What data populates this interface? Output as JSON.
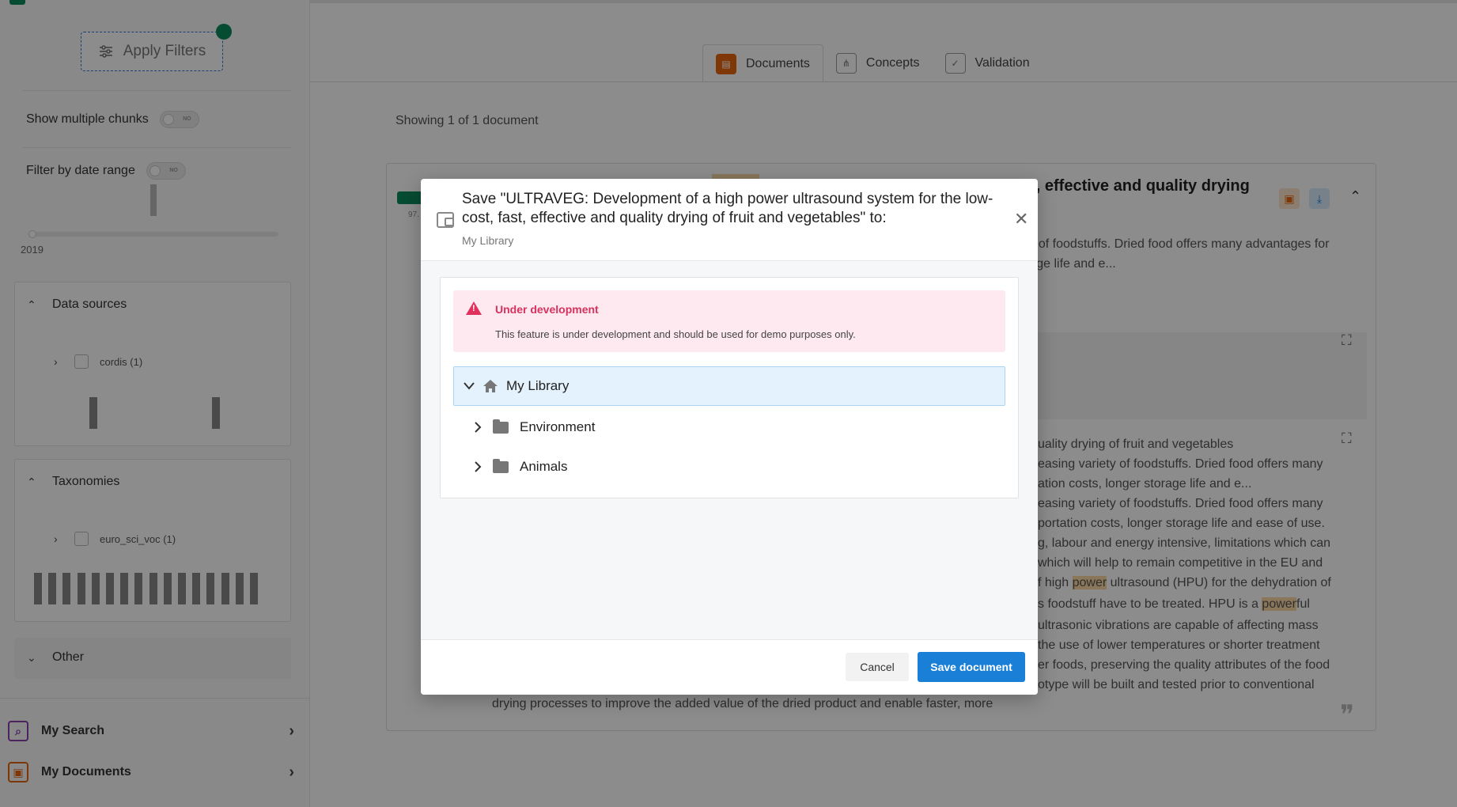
{
  "sidebar": {
    "apply_filters_label": "Apply Filters",
    "show_multiple_chunks_label": "Show multiple chunks",
    "filter_by_date_label": "Filter by date range",
    "toggle_off_text": "NO",
    "date_start_label": "2019",
    "data_sources": {
      "title": "Data sources",
      "items": [
        {
          "label": "cordis (1)"
        }
      ]
    },
    "taxonomies": {
      "title": "Taxonomies",
      "items": [
        {
          "label": "euro_sci_voc (1)"
        }
      ]
    },
    "other": {
      "title": "Other"
    },
    "nav": [
      {
        "label": "My Search",
        "icon": "search-icon",
        "color": "#8b3fb0"
      },
      {
        "label": "My Documents",
        "icon": "document-icon",
        "color": "#e8650d"
      }
    ]
  },
  "main": {
    "tabs": [
      {
        "label": "Documents",
        "active": true
      },
      {
        "label": "Concepts",
        "active": false
      },
      {
        "label": "Validation",
        "active": false
      }
    ],
    "showing_text": "Showing 1 of 1 document",
    "card": {
      "title_visible": "st, effective and quality drying",
      "snippet_lines": [
        "ty of foodstuffs. Dried food offers many advantages for",
        "rage life and e..."
      ],
      "chunk_title": "uality drying of fruit and vegetables",
      "chunk_summary_lines": [
        "easing variety of foodstuffs. Dried food offers many",
        "ation costs, longer storage life and e..."
      ],
      "body_lines": [
        "easing variety of foodstuffs. Dried food offers many",
        "portation costs, longer storage life and ease of use.",
        "g, labour and energy intensive, limitations which can",
        " which will help to remain competitive in the EU and",
        "f high ",
        "s foodstuff have to be treated. HPU is a ",
        "ultrasonic vibrations are capable of affecting mass",
        "the use of lower temperatures or shorter treatment",
        "er foods, preserving the quality attributes of the food",
        "otype will be built and tested prior to conventional",
        "drying processes to improve the added value of the dried product and enable faster, more"
      ],
      "highlight_word": "power",
      "highlight_word_2": "power",
      "line5_rest": " ultrasound (HPU) for the dehydration of",
      "line6_rest": "ful"
    }
  },
  "modal": {
    "title": "Save \"ULTRAVEG: Development of a high power ultrasound system for the low-cost, fast, effective and quality drying of fruit and vegetables\" to:",
    "subtitle": "My Library",
    "warning_title": "Under development",
    "warning_text": "This feature is under development and should be used for demo purposes only.",
    "tree": {
      "root": "My Library",
      "children": [
        "Environment",
        "Animals"
      ]
    },
    "cancel_label": "Cancel",
    "save_label": "Save document"
  }
}
